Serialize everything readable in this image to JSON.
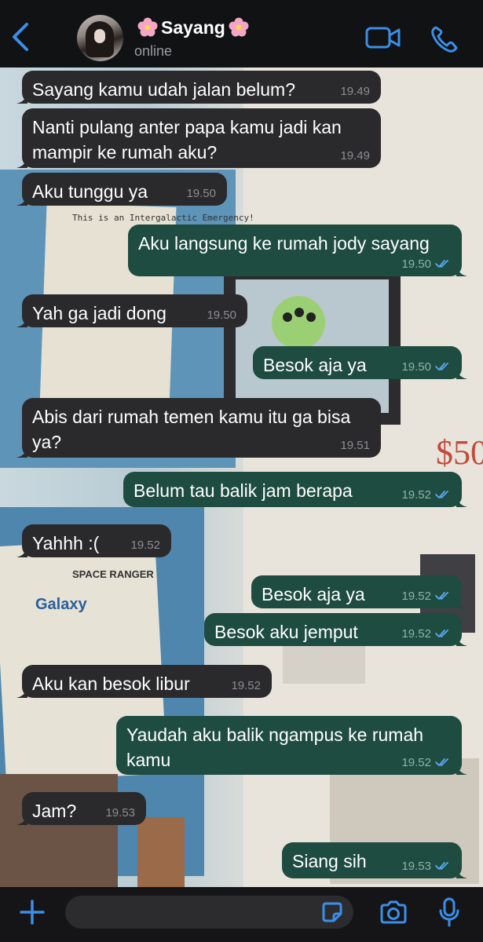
{
  "header": {
    "contact_name": "Sayang",
    "status": "online",
    "icons": [
      "back-chevron-icon",
      "avatar",
      "flower-emoji",
      "video-call-icon",
      "phone-call-icon"
    ]
  },
  "messages": [
    {
      "dir": "in",
      "text": "Sayang kamu udah jalan belum?",
      "time": "19.49"
    },
    {
      "dir": "in",
      "text": "Nanti pulang anter papa kamu jadi kan mampir ke rumah aku?",
      "time": "19.49"
    },
    {
      "dir": "in",
      "text": "Aku tunggu ya",
      "time": "19.50"
    },
    {
      "dir": "out",
      "text": "Aku langsung ke rumah jody sayang",
      "time": "19.50"
    },
    {
      "dir": "in",
      "text": "Yah ga jadi dong",
      "time": "19.50"
    },
    {
      "dir": "out",
      "text": "Besok aja ya",
      "time": "19.50"
    },
    {
      "dir": "in",
      "text": "Abis dari rumah temen kamu itu ga bisa ya?",
      "time": "19.51"
    },
    {
      "dir": "out",
      "text": "Belum tau balik jam berapa",
      "time": "19.52"
    },
    {
      "dir": "in",
      "text": "Yahhh :(",
      "time": "19.52"
    },
    {
      "dir": "out",
      "text": "Besok aja ya",
      "time": "19.52"
    },
    {
      "dir": "out",
      "text": "Besok aku jemput",
      "time": "19.52"
    },
    {
      "dir": "in",
      "text": "Aku kan besok libur",
      "time": "19.52"
    },
    {
      "dir": "out",
      "text": "Yaudah aku balik ngampus ke rumah kamu",
      "time": "19.52"
    },
    {
      "dir": "in",
      "text": "Jam?",
      "time": "19.53"
    },
    {
      "dir": "out",
      "text": "Siang sih",
      "time": "19.53"
    }
  ],
  "wallpaper": {
    "poster_left_top": "This is an Intergalactic Emergency!",
    "poster_left_bottom": "SPACE RANGER",
    "poster_left_brand": "Galaxy",
    "price_tag": "$50"
  },
  "composer": {
    "placeholder": "",
    "icons": [
      "plus-icon",
      "sticker-icon",
      "camera-icon",
      "microphone-icon"
    ]
  },
  "colors": {
    "accent_blue": "#3b8fe8",
    "incoming_bubble": "#2a2a2c",
    "outgoing_bubble": "#1e4c40",
    "read_ticks": "#5aa9f5"
  }
}
